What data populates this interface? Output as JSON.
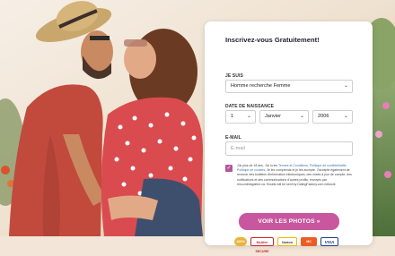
{
  "form": {
    "title": "Inscrivez-vous Gratuitement!",
    "i_am_label": "JE SUIS",
    "i_am_value": "Homme recherche Femme",
    "birthdate_label": "DATE DE NAISSANCE",
    "day": "1",
    "month": "Janvier",
    "year": "2006",
    "email_label": "E-MAIL",
    "email_placeholder": "E-mail",
    "terms_part1": "J'ai plus de 18 ans. J'ai lu les ",
    "terms_link1": "Termes et Conditions",
    "terms_comma": ", ",
    "terms_link2": "Politique de confidentialité",
    "terms_comma2": ", ",
    "terms_link3": "Politique de cookies",
    "terms_part2": ". Je les comprends et je les accepte. J'accepte également de recevoir des bulletins d'information électroniques, des mises à jour de compte, des notifications et des communications d'autres profils, envoyés par rencontresgalere.ca. Emails will be sent by DatingFactory.com network",
    "submit": "VOIR LES PHOTOS »"
  },
  "badges": {
    "b1": "100%",
    "b2": "McAfee SECURE",
    "b3": "Norton",
    "b4": "MC",
    "b5": "VISA"
  },
  "colors": {
    "accent": "#c8579f",
    "checkbox": "#b4579a",
    "link": "#3b6fb6"
  }
}
